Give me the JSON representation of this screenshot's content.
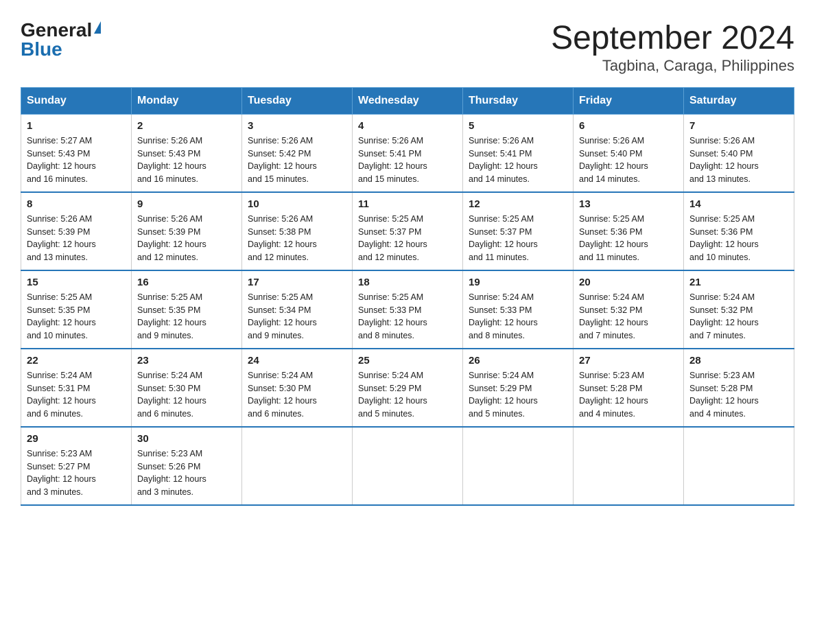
{
  "logo": {
    "general": "General",
    "blue": "Blue"
  },
  "title": "September 2024",
  "subtitle": "Tagbina, Caraga, Philippines",
  "days_of_week": [
    "Sunday",
    "Monday",
    "Tuesday",
    "Wednesday",
    "Thursday",
    "Friday",
    "Saturday"
  ],
  "weeks": [
    [
      {
        "num": "1",
        "sunrise": "5:27 AM",
        "sunset": "5:43 PM",
        "daylight": "12 hours and 16 minutes."
      },
      {
        "num": "2",
        "sunrise": "5:26 AM",
        "sunset": "5:43 PM",
        "daylight": "12 hours and 16 minutes."
      },
      {
        "num": "3",
        "sunrise": "5:26 AM",
        "sunset": "5:42 PM",
        "daylight": "12 hours and 15 minutes."
      },
      {
        "num": "4",
        "sunrise": "5:26 AM",
        "sunset": "5:41 PM",
        "daylight": "12 hours and 15 minutes."
      },
      {
        "num": "5",
        "sunrise": "5:26 AM",
        "sunset": "5:41 PM",
        "daylight": "12 hours and 14 minutes."
      },
      {
        "num": "6",
        "sunrise": "5:26 AM",
        "sunset": "5:40 PM",
        "daylight": "12 hours and 14 minutes."
      },
      {
        "num": "7",
        "sunrise": "5:26 AM",
        "sunset": "5:40 PM",
        "daylight": "12 hours and 13 minutes."
      }
    ],
    [
      {
        "num": "8",
        "sunrise": "5:26 AM",
        "sunset": "5:39 PM",
        "daylight": "12 hours and 13 minutes."
      },
      {
        "num": "9",
        "sunrise": "5:26 AM",
        "sunset": "5:39 PM",
        "daylight": "12 hours and 12 minutes."
      },
      {
        "num": "10",
        "sunrise": "5:26 AM",
        "sunset": "5:38 PM",
        "daylight": "12 hours and 12 minutes."
      },
      {
        "num": "11",
        "sunrise": "5:25 AM",
        "sunset": "5:37 PM",
        "daylight": "12 hours and 12 minutes."
      },
      {
        "num": "12",
        "sunrise": "5:25 AM",
        "sunset": "5:37 PM",
        "daylight": "12 hours and 11 minutes."
      },
      {
        "num": "13",
        "sunrise": "5:25 AM",
        "sunset": "5:36 PM",
        "daylight": "12 hours and 11 minutes."
      },
      {
        "num": "14",
        "sunrise": "5:25 AM",
        "sunset": "5:36 PM",
        "daylight": "12 hours and 10 minutes."
      }
    ],
    [
      {
        "num": "15",
        "sunrise": "5:25 AM",
        "sunset": "5:35 PM",
        "daylight": "12 hours and 10 minutes."
      },
      {
        "num": "16",
        "sunrise": "5:25 AM",
        "sunset": "5:35 PM",
        "daylight": "12 hours and 9 minutes."
      },
      {
        "num": "17",
        "sunrise": "5:25 AM",
        "sunset": "5:34 PM",
        "daylight": "12 hours and 9 minutes."
      },
      {
        "num": "18",
        "sunrise": "5:25 AM",
        "sunset": "5:33 PM",
        "daylight": "12 hours and 8 minutes."
      },
      {
        "num": "19",
        "sunrise": "5:24 AM",
        "sunset": "5:33 PM",
        "daylight": "12 hours and 8 minutes."
      },
      {
        "num": "20",
        "sunrise": "5:24 AM",
        "sunset": "5:32 PM",
        "daylight": "12 hours and 7 minutes."
      },
      {
        "num": "21",
        "sunrise": "5:24 AM",
        "sunset": "5:32 PM",
        "daylight": "12 hours and 7 minutes."
      }
    ],
    [
      {
        "num": "22",
        "sunrise": "5:24 AM",
        "sunset": "5:31 PM",
        "daylight": "12 hours and 6 minutes."
      },
      {
        "num": "23",
        "sunrise": "5:24 AM",
        "sunset": "5:30 PM",
        "daylight": "12 hours and 6 minutes."
      },
      {
        "num": "24",
        "sunrise": "5:24 AM",
        "sunset": "5:30 PM",
        "daylight": "12 hours and 6 minutes."
      },
      {
        "num": "25",
        "sunrise": "5:24 AM",
        "sunset": "5:29 PM",
        "daylight": "12 hours and 5 minutes."
      },
      {
        "num": "26",
        "sunrise": "5:24 AM",
        "sunset": "5:29 PM",
        "daylight": "12 hours and 5 minutes."
      },
      {
        "num": "27",
        "sunrise": "5:23 AM",
        "sunset": "5:28 PM",
        "daylight": "12 hours and 4 minutes."
      },
      {
        "num": "28",
        "sunrise": "5:23 AM",
        "sunset": "5:28 PM",
        "daylight": "12 hours and 4 minutes."
      }
    ],
    [
      {
        "num": "29",
        "sunrise": "5:23 AM",
        "sunset": "5:27 PM",
        "daylight": "12 hours and 3 minutes."
      },
      {
        "num": "30",
        "sunrise": "5:23 AM",
        "sunset": "5:26 PM",
        "daylight": "12 hours and 3 minutes."
      },
      null,
      null,
      null,
      null,
      null
    ]
  ],
  "labels": {
    "sunrise": "Sunrise:",
    "sunset": "Sunset:",
    "daylight": "Daylight:"
  }
}
